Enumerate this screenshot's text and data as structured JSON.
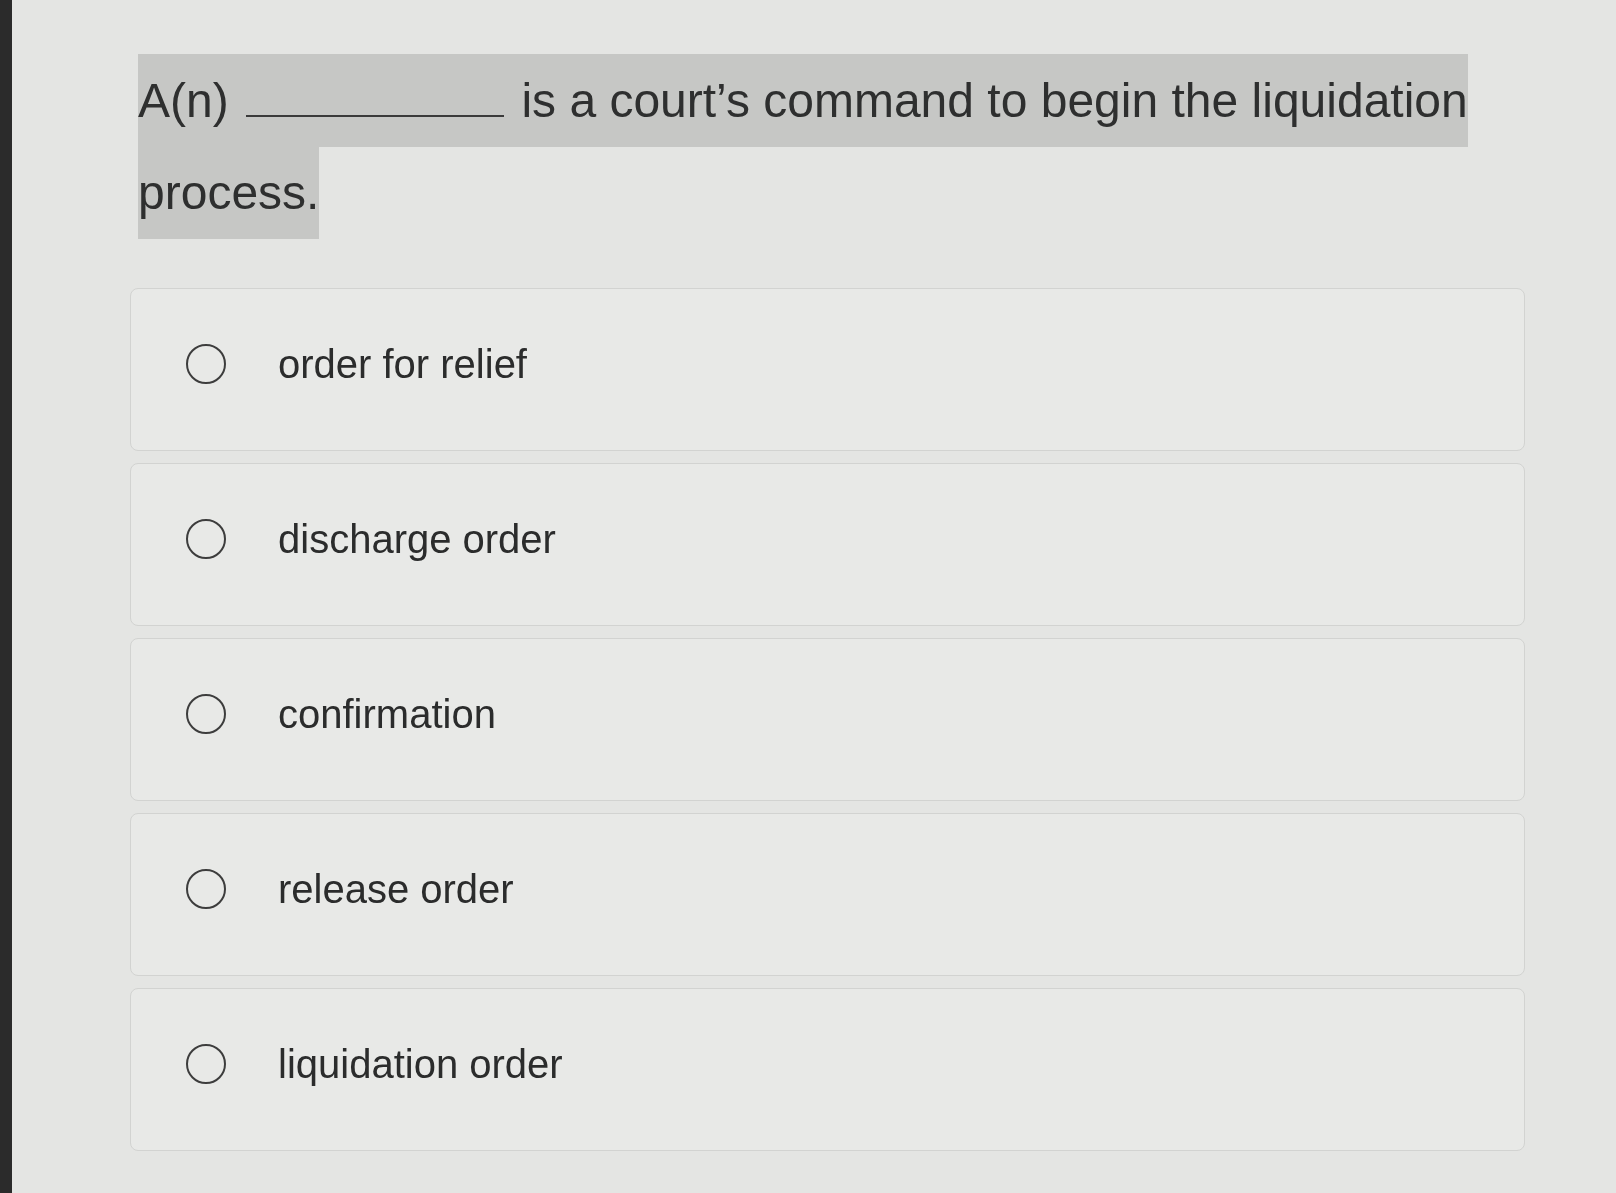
{
  "question": {
    "text_before": "A(n)",
    "text_after": "is a court’s command to begin the liquidation process.",
    "highlighted": true
  },
  "options": [
    {
      "label": "order for relief",
      "selected": false
    },
    {
      "label": "discharge order",
      "selected": false
    },
    {
      "label": "confirmation",
      "selected": false
    },
    {
      "label": "release order",
      "selected": false
    },
    {
      "label": "liquidation order",
      "selected": false
    }
  ]
}
